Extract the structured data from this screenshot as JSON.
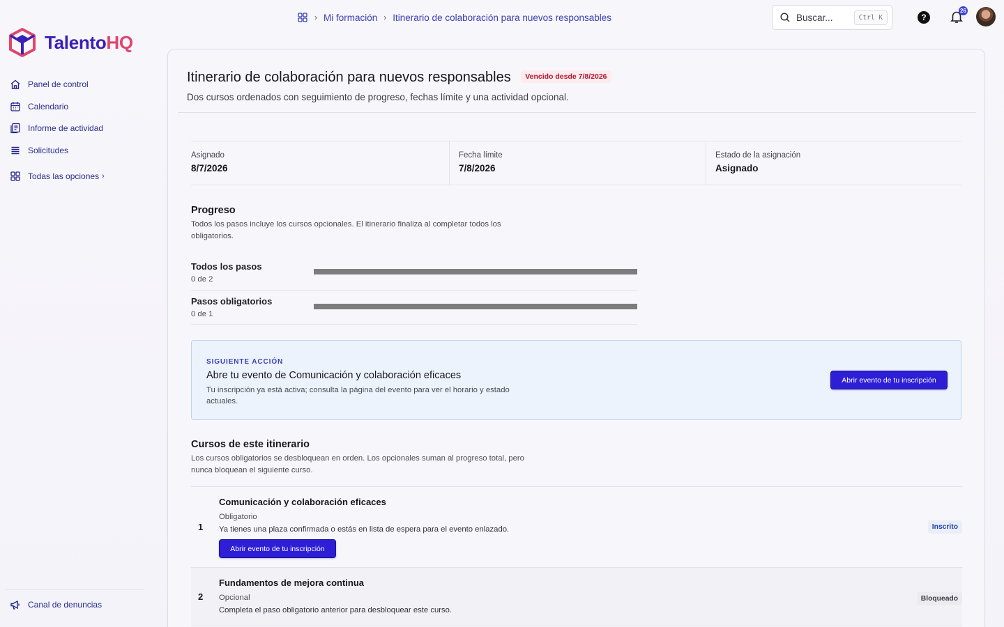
{
  "app": {
    "logo_main": "Talento",
    "logo_accent": "HQ"
  },
  "sidebar": {
    "items": [
      {
        "label": "Panel de control",
        "icon": "home-icon"
      },
      {
        "label": "Calendario",
        "icon": "calendar-icon"
      },
      {
        "label": "Informe de actividad",
        "icon": "report-icon"
      },
      {
        "label": "Solicitudes",
        "icon": "list-icon"
      }
    ],
    "all_options": "Todas las opciones",
    "footer_item": "Canal de denuncias"
  },
  "topbar": {
    "breadcrumb": [
      "Mi formación",
      "Itinerario de colaboración para nuevos responsables"
    ],
    "search_placeholder": "Buscar...",
    "search_shortcut": "Ctrl K",
    "help_label": "?",
    "notifications_count": "26"
  },
  "page": {
    "title": "Itinerario de colaboración para nuevos responsables",
    "overdue_badge": "Vencido desde 7/8/2026",
    "subtitle": "Dos cursos ordenados con seguimiento de progreso, fechas límite y una actividad opcional."
  },
  "meta": [
    {
      "label": "Asignado",
      "value": "8/7/2026"
    },
    {
      "label": "Fecha límite",
      "value": "7/8/2026"
    },
    {
      "label": "Estado de la asignación",
      "value": "Asignado"
    }
  ],
  "progress": {
    "title": "Progreso",
    "description": "Todos los pasos incluye los cursos opcionales. El itinerario finaliza al completar todos los obligatorios.",
    "rows": [
      {
        "name": "Todos los pasos",
        "count": "0 de 2",
        "fraction": 0
      },
      {
        "name": "Pasos obligatorios",
        "count": "0 de 1",
        "fraction": 0
      }
    ]
  },
  "next_action": {
    "eyebrow": "SIGUIENTE ACCIÓN",
    "title": "Abre tu evento de Comunicación y colaboración eficaces",
    "description": "Tu inscripción ya está activa; consulta la página del evento para ver el horario y estado actuales.",
    "button": "Abrir evento de tu inscripción"
  },
  "courses": {
    "title": "Cursos de este itinerario",
    "description": "Los cursos obligatorios se desbloquean en orden. Los opcionales suman al progreso total, pero nunca bloquean el siguiente curso.",
    "items": [
      {
        "number": "1",
        "title": "Comunicación y colaboración eficaces",
        "type": "Obligatorio",
        "description": "Ya tienes una plaza confirmada o estás en lista de espera para el evento enlazado.",
        "button": "Abrir evento de tu inscripción",
        "status": "Inscrito"
      },
      {
        "number": "2",
        "title": "Fundamentos de mejora continua",
        "type": "Opcional",
        "description": "Completa el paso obligatorio anterior para desbloquear este curso.",
        "status": "Bloqueado"
      }
    ]
  },
  "colors": {
    "accent": "#2e1fd6",
    "brand": "#3a1fb8",
    "brand_accent": "#e0456d",
    "overdue": "#b1142f"
  }
}
